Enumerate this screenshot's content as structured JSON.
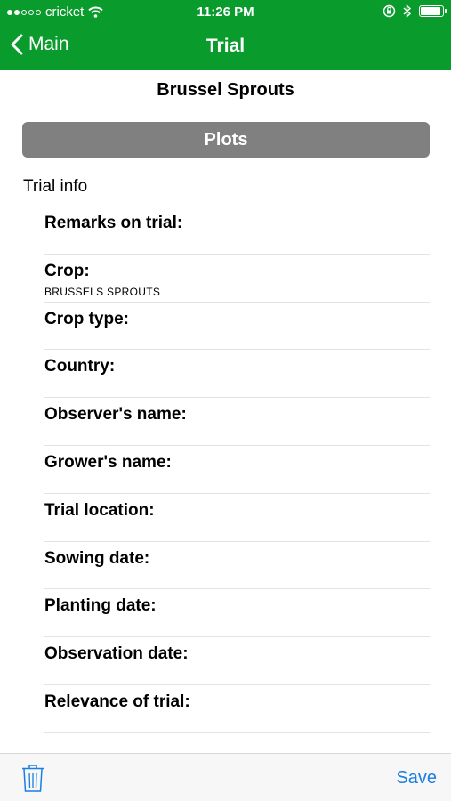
{
  "status_bar": {
    "carrier": "cricket",
    "time": "11:26 PM"
  },
  "nav": {
    "back_label": "Main",
    "title": "Trial"
  },
  "subtitle": "Brussel Sprouts",
  "plots_button": "Plots",
  "section_label": "Trial info",
  "fields": [
    {
      "label": "Remarks on trial:",
      "value": ""
    },
    {
      "label": "Crop:",
      "value": "BRUSSELS SPROUTS"
    },
    {
      "label": "Crop type:",
      "value": ""
    },
    {
      "label": "Country:",
      "value": ""
    },
    {
      "label": "Observer's name:",
      "value": ""
    },
    {
      "label": "Grower's name:",
      "value": ""
    },
    {
      "label": "Trial location:",
      "value": ""
    },
    {
      "label": "Sowing date:",
      "value": ""
    },
    {
      "label": "Planting date:",
      "value": ""
    },
    {
      "label": "Observation date:",
      "value": ""
    },
    {
      "label": "Relevance of trial:",
      "value": ""
    }
  ],
  "toolbar": {
    "save_label": "Save",
    "delete_icon": "trash-icon"
  },
  "colors": {
    "header": "#0a9b2d",
    "button_gray": "#808080",
    "save_blue": "#1a7fe0"
  }
}
